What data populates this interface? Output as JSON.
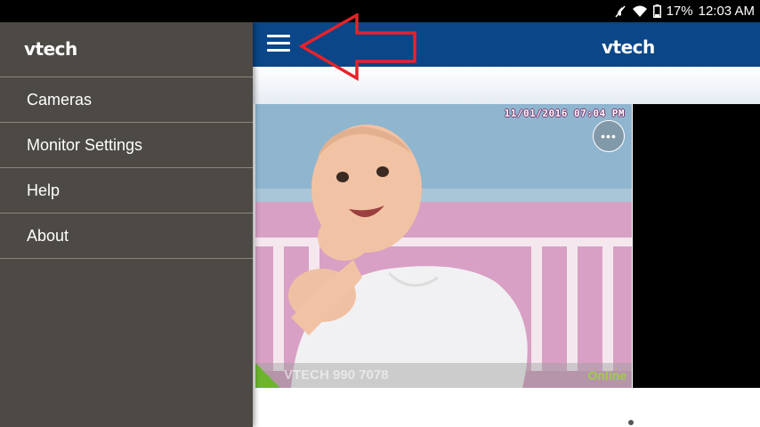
{
  "status_bar": {
    "battery": "17%",
    "time": "12:03 AM",
    "icons": [
      "mute-icon",
      "wifi-icon",
      "battery-icon"
    ]
  },
  "appbar": {
    "logo": "vtech",
    "menu_icon": "hamburger-menu-icon",
    "color": "#0a4688"
  },
  "drawer": {
    "logo": "vtech",
    "background": "#4d4944",
    "items": [
      {
        "label": "Cameras"
      },
      {
        "label": "Monitor Settings"
      },
      {
        "label": "Help"
      },
      {
        "label": "About"
      }
    ]
  },
  "camera": {
    "timestamp": "11/01/2016 07:04 PM",
    "more_label": "•••",
    "name": "VTECH 990 7078",
    "status": "Online",
    "status_color": "#9dcf46"
  },
  "annotation": {
    "arrow_color": "#e8222a",
    "points_to": "hamburger-menu-icon"
  }
}
